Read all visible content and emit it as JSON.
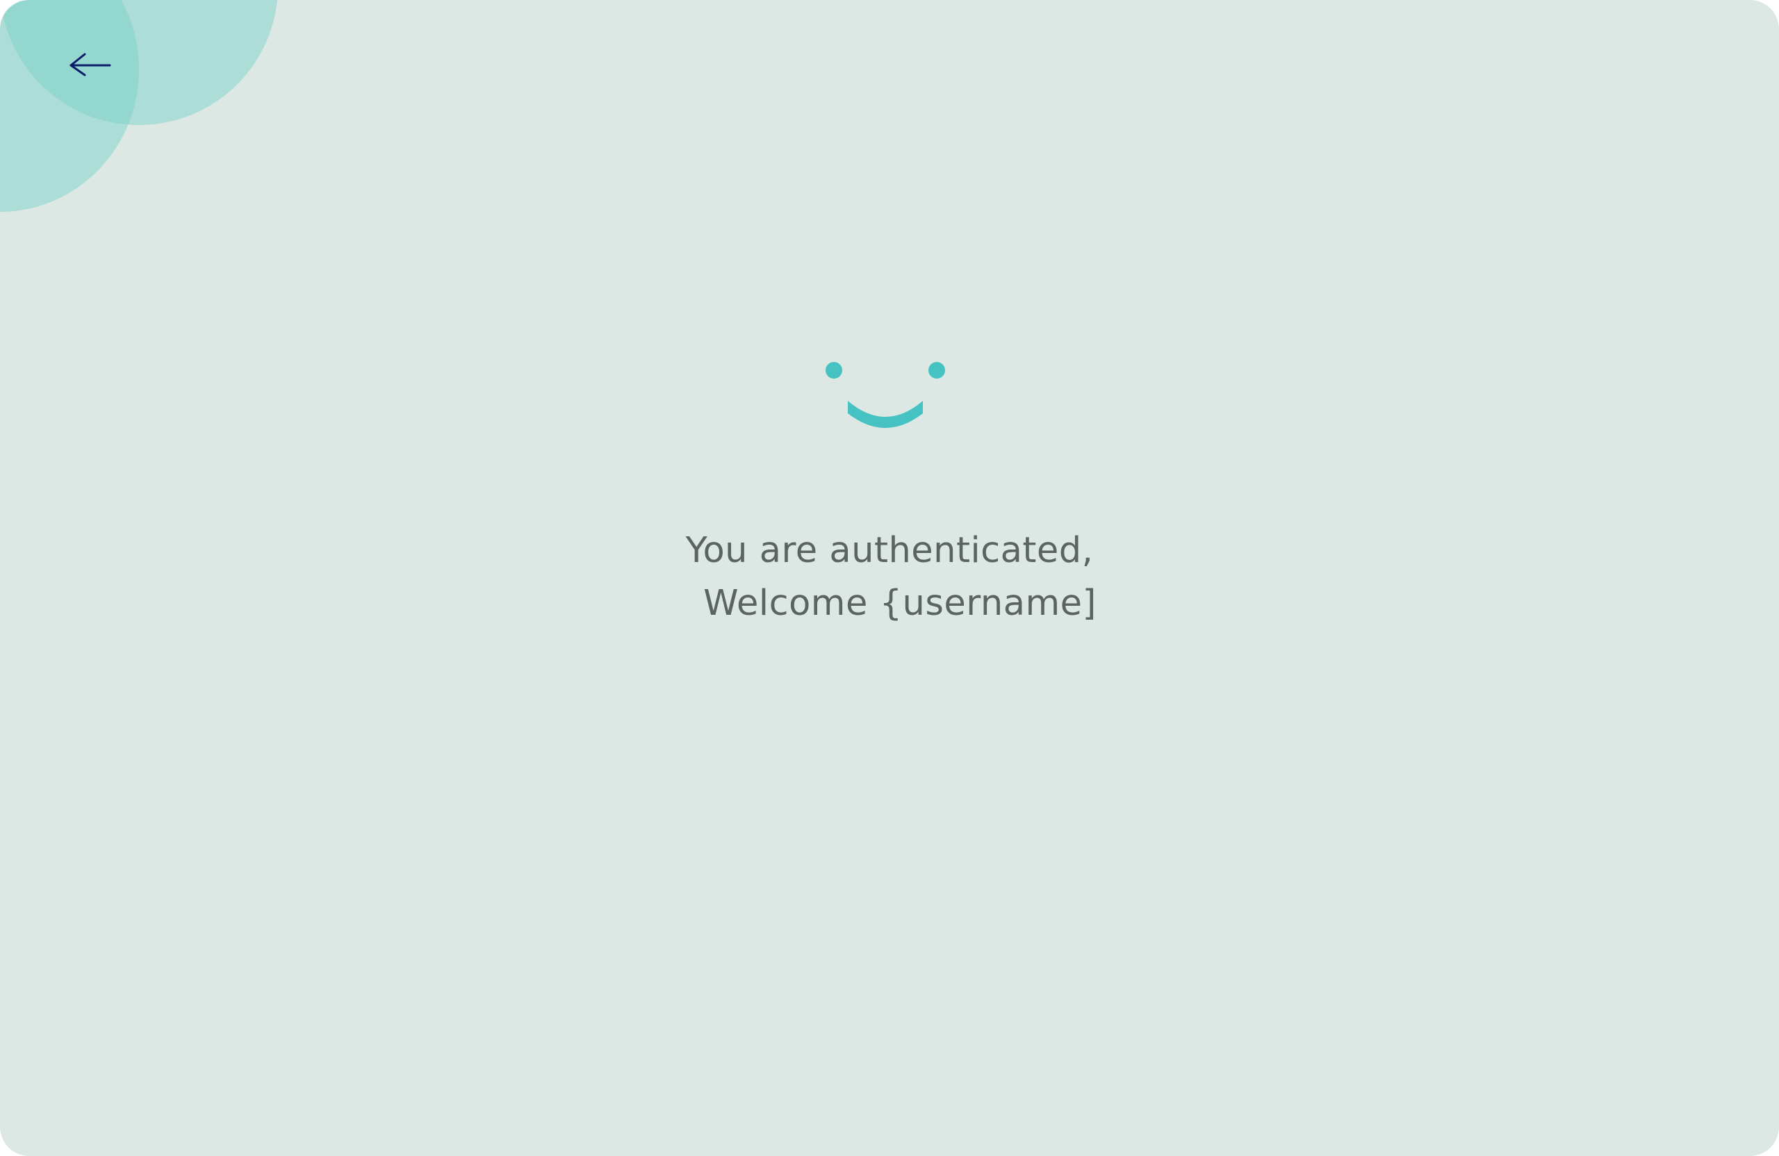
{
  "colors": {
    "background": "#dde8e5",
    "accent": "#45c2c1",
    "decor": "#8fd6cc",
    "text": "#5b6462",
    "icon": "#0b1b6b"
  },
  "nav": {
    "back_icon": "arrow-left-icon"
  },
  "illustration": {
    "icon": "smiley-face-icon"
  },
  "message": {
    "line1": "You are authenticated,",
    "line2": "Welcome {username]"
  }
}
